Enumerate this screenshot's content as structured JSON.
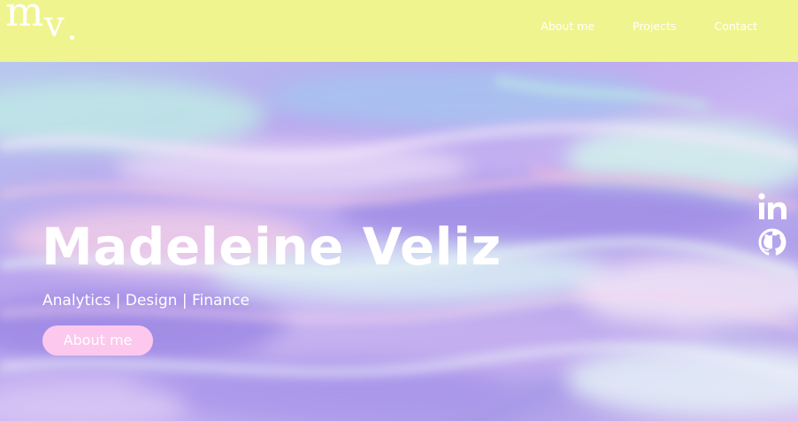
{
  "header": {
    "logo": {
      "letter_m": "m",
      "letter_v": "v"
    },
    "nav": [
      {
        "label": "About me"
      },
      {
        "label": "Projects"
      },
      {
        "label": "Contact"
      }
    ],
    "background_color": "#f0f48f"
  },
  "hero": {
    "name": "Madeleine Veliz",
    "tagline": "Analytics | Design | Finance",
    "cta_label": "About me",
    "cta_color": "#fcc8ee",
    "background": "holographic iridescent foil texture",
    "social_icons": [
      "linkedin-icon",
      "github-icon"
    ]
  }
}
